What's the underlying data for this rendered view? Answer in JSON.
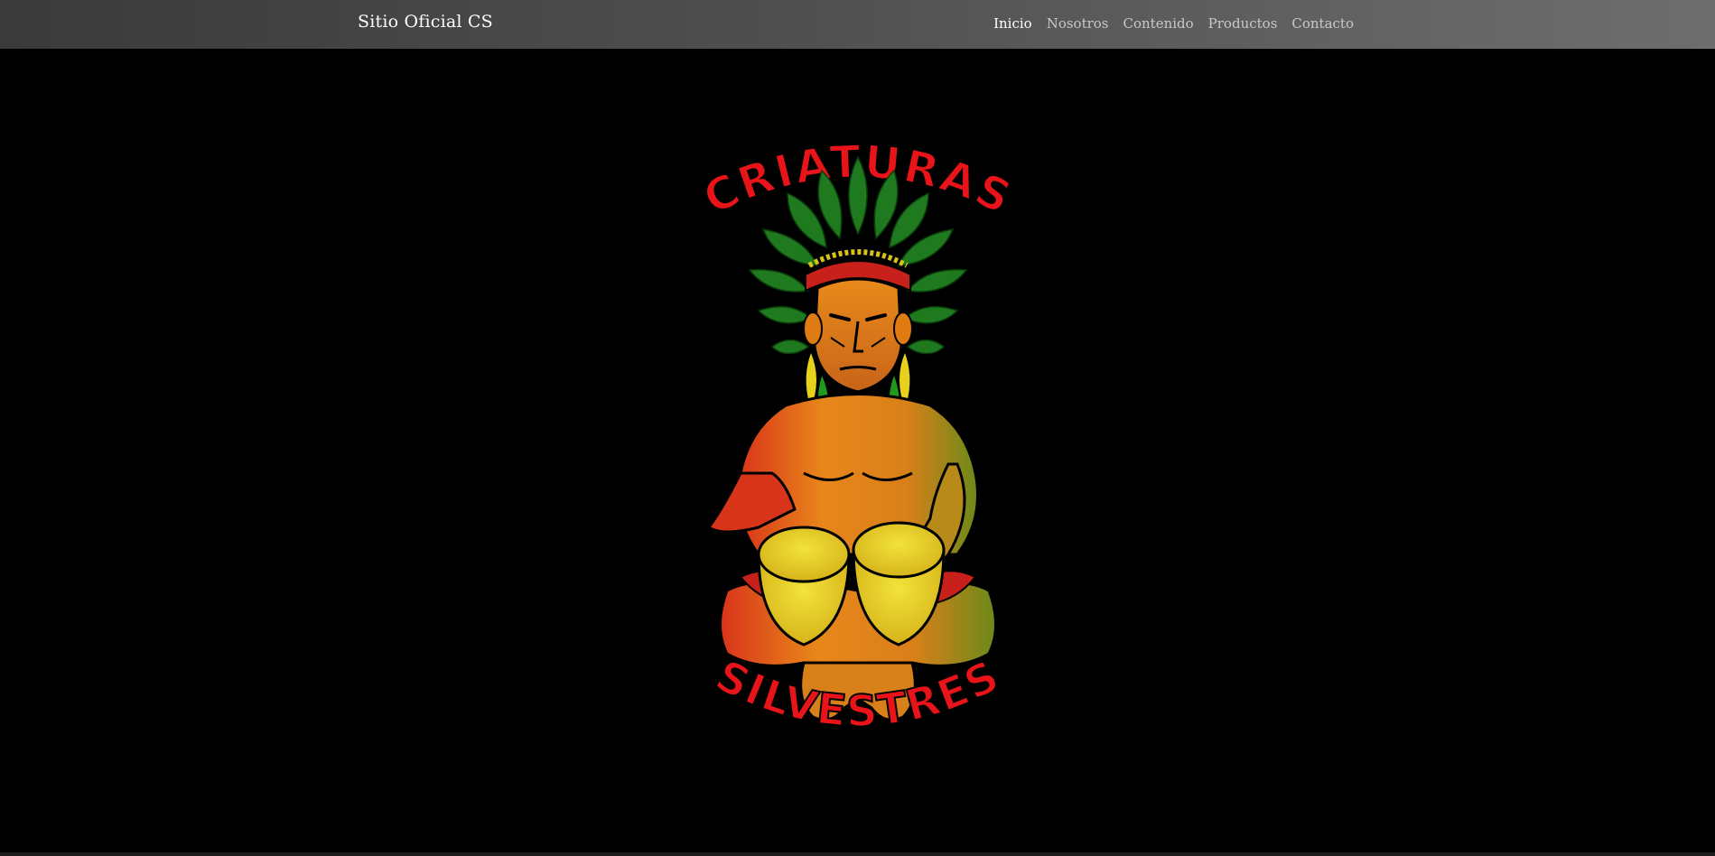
{
  "navbar": {
    "brand": "Sitio Oficial CS",
    "items": [
      {
        "label": "Inicio",
        "active": true
      },
      {
        "label": "Nosotros",
        "active": false
      },
      {
        "label": "Contenido",
        "active": false
      },
      {
        "label": "Productos",
        "active": false
      },
      {
        "label": "Contacto",
        "active": false
      }
    ]
  },
  "hero": {
    "logo_top_text": "CRIATURAS",
    "logo_bottom_text": "SILVESTRES",
    "colors": {
      "background": "#000000",
      "logo_text": "#e8141a",
      "feather_green": "#1f7a1f",
      "skin_orange": "#e07a12",
      "drum_yellow": "#e6c21a"
    }
  }
}
